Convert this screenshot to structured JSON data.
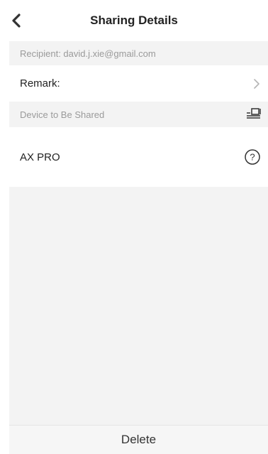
{
  "header": {
    "title": "Sharing Details",
    "back_icon": "chevron-left-icon"
  },
  "recipient": {
    "label": "Recipient: david.j.xie@gmail.com"
  },
  "remark": {
    "label": "Remark:",
    "chevron_icon": "chevron-right-icon"
  },
  "device_section": {
    "label": "Device to Be Shared",
    "icon": "device-edit-icon"
  },
  "device": {
    "name": "AX PRO",
    "help_icon": "help-circle-icon"
  },
  "footer": {
    "delete_label": "Delete"
  },
  "colors": {
    "section_bg": "#f3f3f3",
    "section_text": "#9a9a9a",
    "primary_text": "#222222"
  }
}
